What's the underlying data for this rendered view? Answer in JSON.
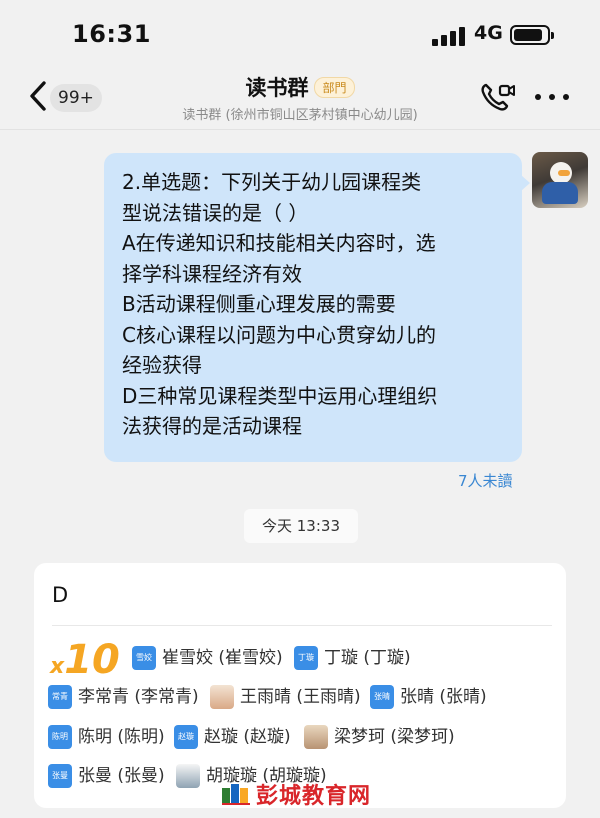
{
  "status_bar": {
    "time": "16:31",
    "network": "4G"
  },
  "nav": {
    "back_count": "99+",
    "title": "读书群",
    "dept_tag": "部門",
    "subtitle": "读书群 (徐州市铜山区茅村镇中心幼儿园)"
  },
  "message": {
    "lines": [
      "2.单选题：下列关于幼儿园课程类",
      "型说法错误的是（ ）",
      "A在传递知识和技能相关内容时，选",
      "择学科课程经济有效",
      "B活动课程侧重心理发展的需要",
      "C核心课程以问题为中心贯穿幼儿的",
      "经验获得",
      "D三种常见课程类型中运用心理组织",
      "法获得的是活动课程"
    ],
    "unread": "7人未讀"
  },
  "timestamp": "今天 13:33",
  "reply_card": {
    "answer": "D",
    "plus_prefix": "x",
    "plus_count": "10",
    "people": [
      {
        "avatar": "雪姣",
        "name": "崔雪姣 (崔雪姣)"
      },
      {
        "avatar": "丁璇",
        "name": "丁璇 (丁璇)"
      },
      {
        "avatar": "常青",
        "name": "李常青 (李常青)"
      },
      {
        "avatar": "",
        "name": "王雨晴 (王雨晴)"
      },
      {
        "avatar": "张晴",
        "name": "张晴 (张晴)"
      },
      {
        "avatar": "陈明",
        "name": "陈明 (陈明)"
      },
      {
        "avatar": "赵璇",
        "name": "赵璇 (赵璇)"
      },
      {
        "avatar": "",
        "name": "梁梦珂 (梁梦珂)"
      },
      {
        "avatar": "张曼",
        "name": "张曼 (张曼)"
      },
      {
        "avatar": "",
        "name": "胡璇璇 (胡璇璇)"
      }
    ]
  },
  "watermark": "彭城教育网",
  "colors": {
    "bubble": "#cfe5fa",
    "accent_blue": "#3a87d2",
    "plus_orange": "#f5a623",
    "avatar_blue": "#3a8ee6",
    "watermark_red": "#d9262a"
  }
}
